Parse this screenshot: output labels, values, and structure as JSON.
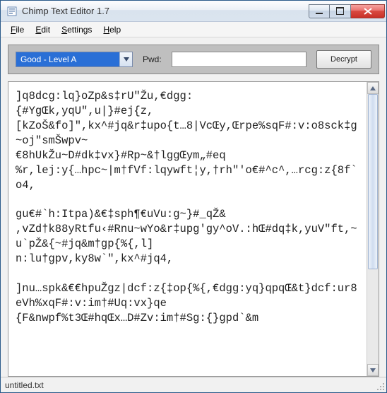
{
  "window": {
    "title": "Chimp Text Editor 1.7"
  },
  "menu": {
    "file": "File",
    "edit": "Edit",
    "settings": "Settings",
    "help": "Help"
  },
  "toolbar": {
    "level_options": [
      "Good - Level A"
    ],
    "level_selected": "Good - Level A",
    "pwd_label": "Pwd:",
    "pwd_value": "",
    "decrypt_label": "Decrypt"
  },
  "editor": {
    "content": "]q8dcg:lq}oZp&s‡rU\"Žu,€dgg:\n{#YgŒk,yqU\",u|}#ej{z,\n[kZoŠ&fo]\",kx^#jq&r‡upo{t…8|VcŒy,Œrpe%sqF#:v:o8sck‡g~oj\"smŠwpv~\n€8hUkŽu~D#dk‡vx}#Rp~&†lggŒym„#eq\n%r,lej:y{…hpc~|m†fVf:lqywft¦y,†rh\"'o€#^c^,…rcg:z{8f`o4,\n\ngu€#`h:Itpa)&€‡sph¶€uVu:g~}#_qŽ&\n,vZd†k88yRtfu‹#Rnu~wYo&r‡upg'gy^oV.:hŒ#dq‡k,yuV\"ft,~u`pŽ&{~#jq&m†gp{%{,l]\nn:lu†gpv,ky8w`\",kx^#jq4,\n\n]nu…spk&€€hpuŽgz|dcf:z{‡op{%{,€dgg:yq}qpqŒ&t}dcf:ur8eVh%xqF#:v:im†#Uq:vx}qe\n{F&nwpf%t3Œ#hqŒx…D#Zv:im†#Sg:{}gpd`&m"
  },
  "status": {
    "filename": "untitled.txt"
  }
}
